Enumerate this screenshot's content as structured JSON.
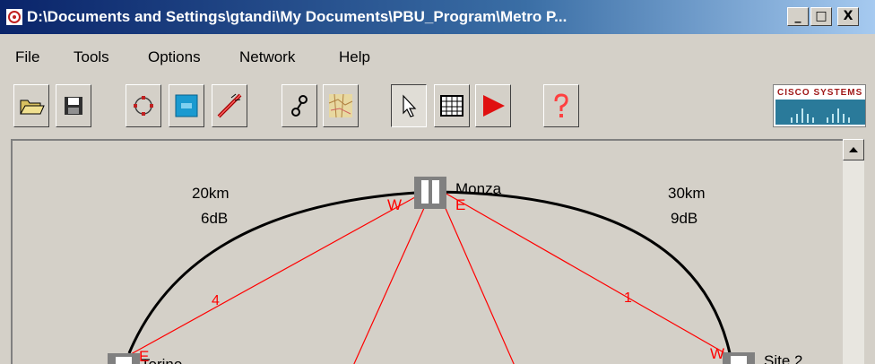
{
  "window": {
    "title": "D:\\Documents and Settings\\gtandi\\My Documents\\PBU_Program\\Metro P...",
    "minimize_label": "_",
    "maximize_label": "□",
    "close_label": "X"
  },
  "menu": {
    "items": [
      "File",
      "Tools",
      "Options",
      "Network",
      "Help"
    ]
  },
  "toolbar": {
    "buttons": [
      "open-folder-icon",
      "save-icon",
      "ring-icon",
      "node-icon",
      "fiber-link-icon",
      "connection-icon",
      "map-icon",
      "pointer-icon",
      "grid-table-icon",
      "play-icon",
      "help-icon"
    ],
    "brand_text": "CISCO SYSTEMS"
  },
  "network": {
    "nodes": [
      {
        "name": "Monza",
        "east_label": "E",
        "west_label": "W"
      },
      {
        "name": "Torino",
        "east_label": "E"
      },
      {
        "name": "Site 2",
        "west_label": "W"
      }
    ],
    "spans": [
      {
        "distance": "20km",
        "loss": "6dB"
      },
      {
        "distance": "30km",
        "loss": "9dB"
      }
    ],
    "connections": [
      {
        "label": "4"
      },
      {
        "label": "1"
      }
    ]
  },
  "colors": {
    "title_bar": "#0a246a",
    "connection_line": "#ff0000",
    "fiber_span": "#000000"
  }
}
